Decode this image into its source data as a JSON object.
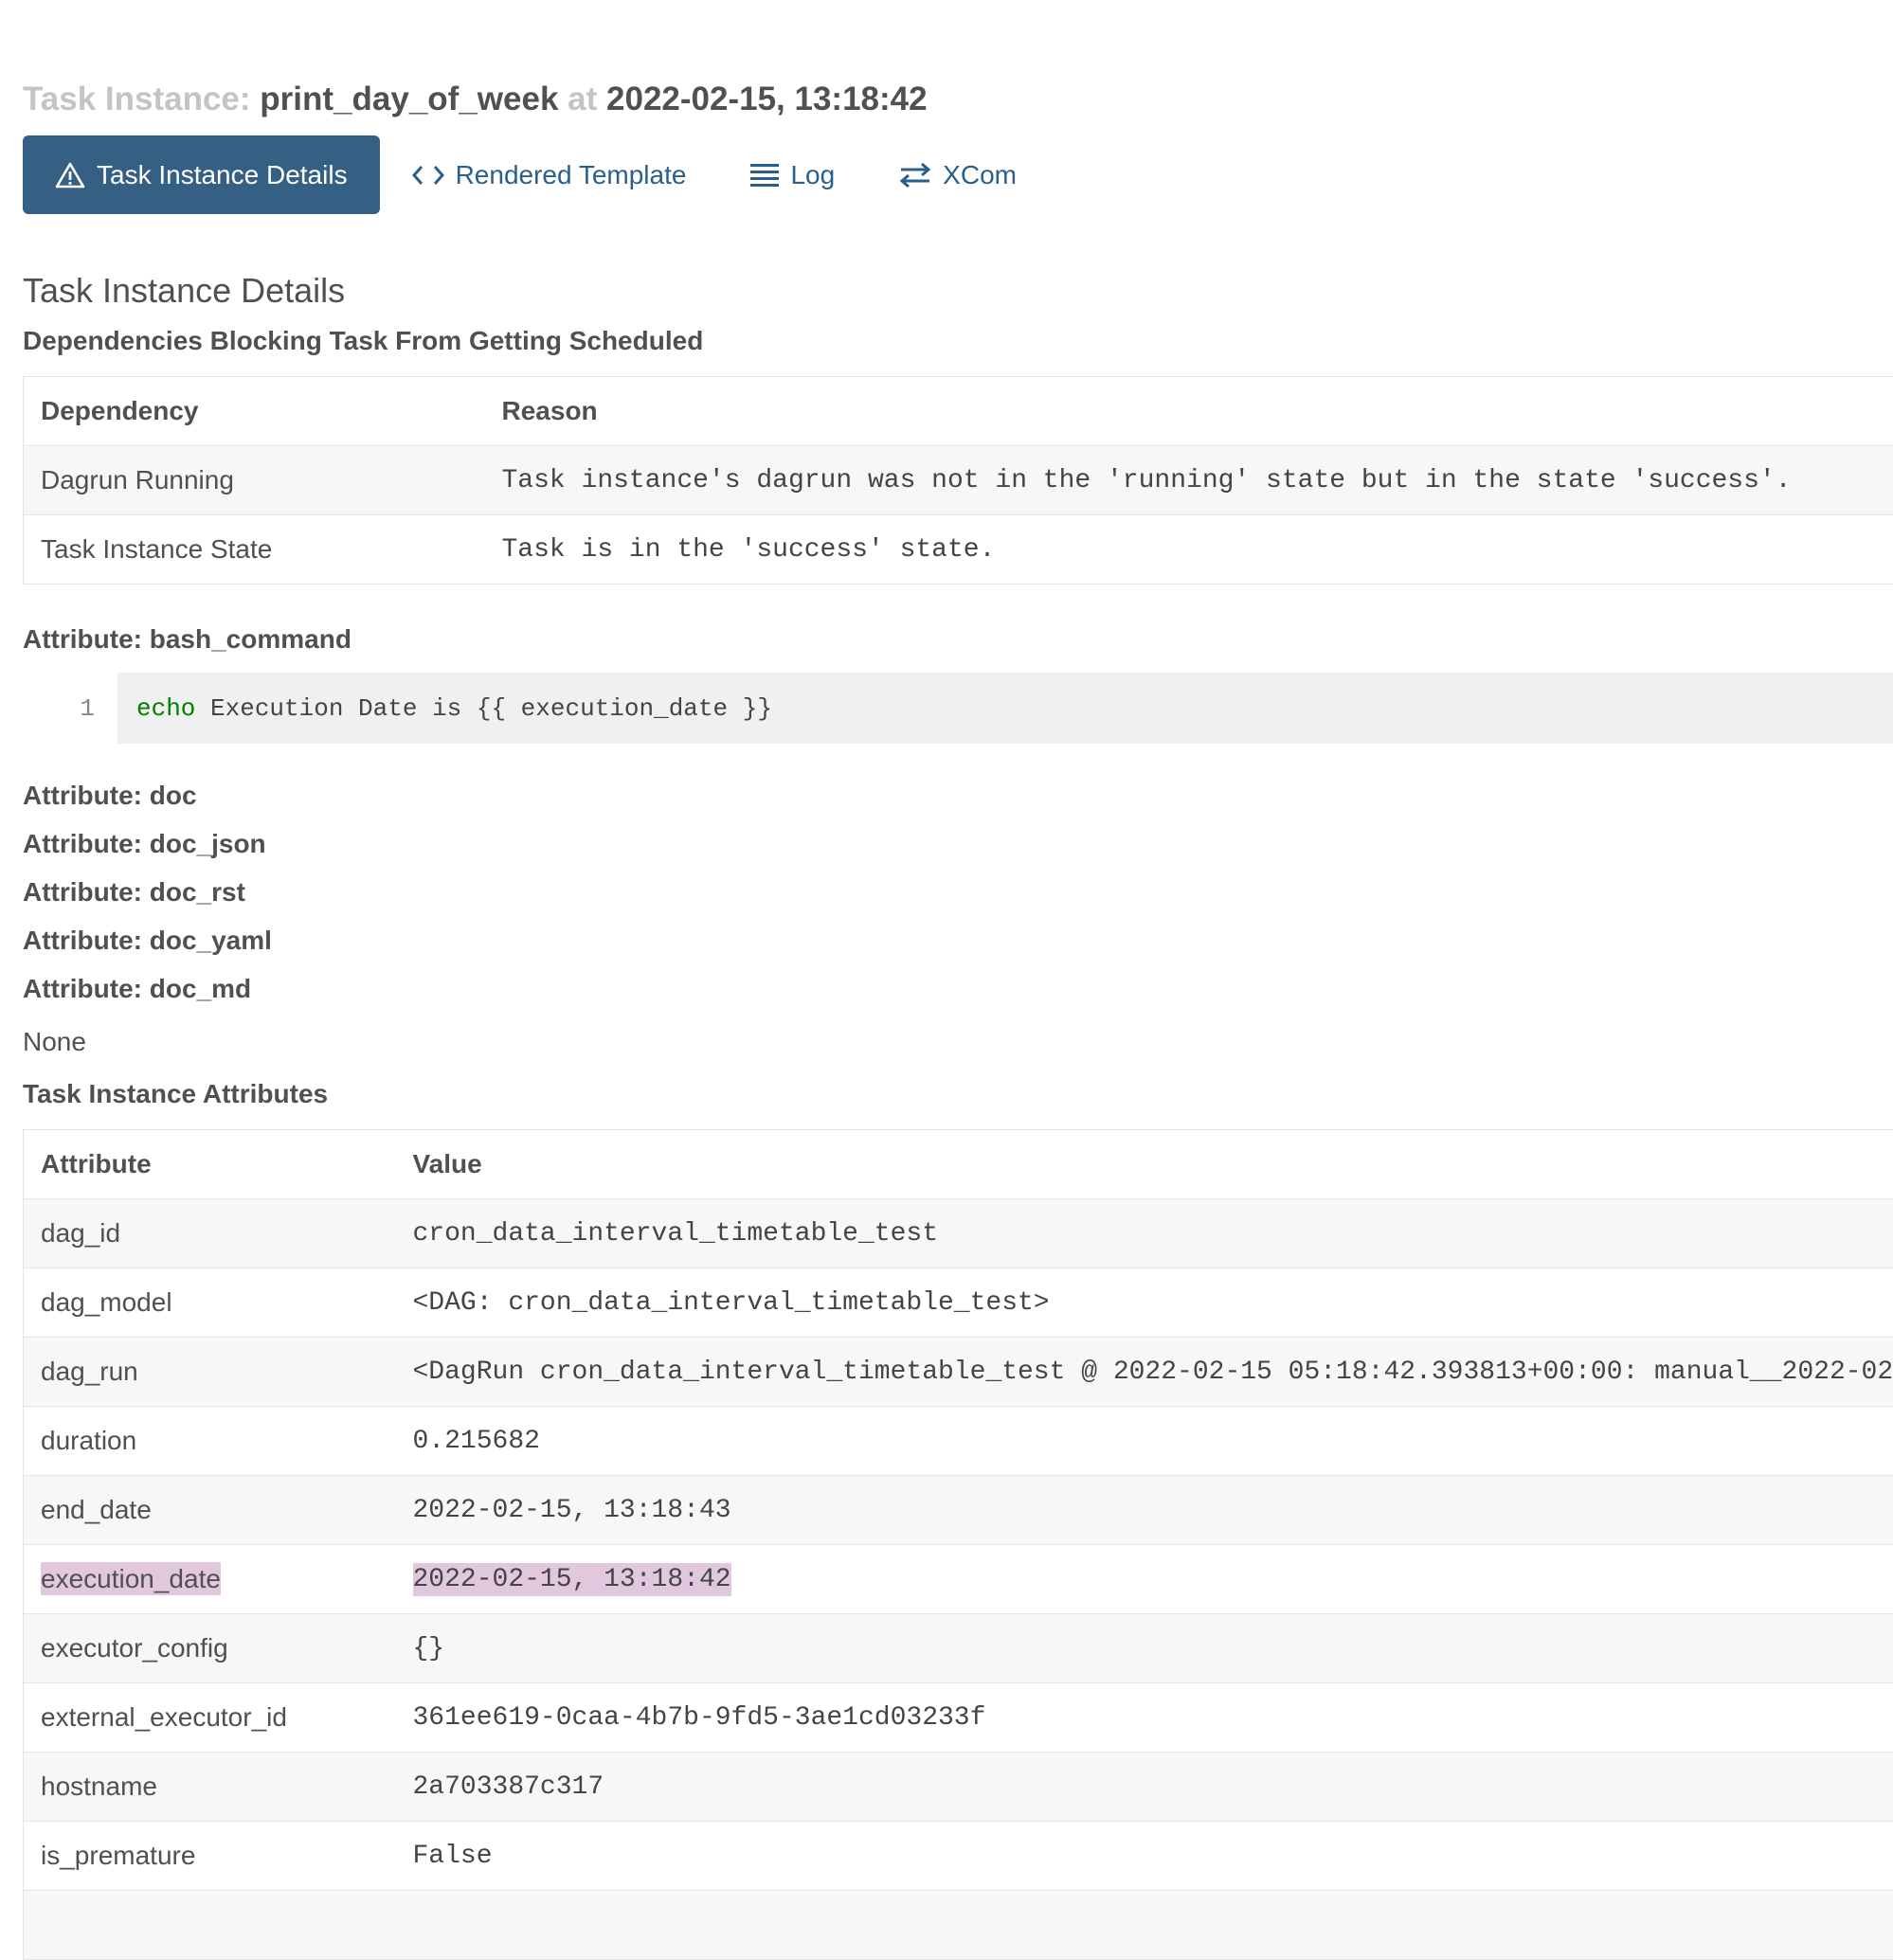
{
  "header": {
    "prefix": "Task Instance:",
    "task_id": "print_day_of_week",
    "at": "at",
    "timestamp": "2022-02-15, 13:18:42"
  },
  "tabs": [
    {
      "label": "Task Instance Details",
      "icon": "warning-icon",
      "active": true
    },
    {
      "label": "Rendered Template",
      "icon": "code-icon",
      "active": false
    },
    {
      "label": "Log",
      "icon": "list-icon",
      "active": false
    },
    {
      "label": "XCom",
      "icon": "exchange-icon",
      "active": false
    }
  ],
  "section_title": "Task Instance Details",
  "deps": {
    "title": "Dependencies Blocking Task From Getting Scheduled",
    "columns": [
      "Dependency",
      "Reason"
    ],
    "rows": [
      [
        "Dagrun Running",
        "Task instance's dagrun was not in the 'running' state but in the state 'success'."
      ],
      [
        "Task Instance State",
        "Task is in the 'success' state."
      ]
    ]
  },
  "bash_command": {
    "label": "Attribute: bash_command",
    "line_number": "1",
    "keyword": "echo",
    "rest": " Execution Date is {{ execution_date }}"
  },
  "doc_attributes": [
    "Attribute: doc",
    "Attribute: doc_json",
    "Attribute: doc_rst",
    "Attribute: doc_yaml",
    "Attribute: doc_md"
  ],
  "doc_md_value": "None",
  "attributes": {
    "title": "Task Instance Attributes",
    "columns": [
      "Attribute",
      "Value"
    ],
    "rows": [
      [
        "dag_id",
        "cron_data_interval_timetable_test"
      ],
      [
        "dag_model",
        "<DAG: cron_data_interval_timetable_test>"
      ],
      [
        "dag_run",
        "<DagRun cron_data_interval_timetable_test @ 2022-02-15 05:18:42.393813+00:00: manual__2022-02"
      ],
      [
        "duration",
        "0.215682"
      ],
      [
        "end_date",
        "2022-02-15, 13:18:43"
      ],
      [
        "execution_date",
        "2022-02-15, 13:18:42"
      ],
      [
        "executor_config",
        "{}"
      ],
      [
        "external_executor_id",
        "361ee619-0caa-4b7b-9fd5-3ae1cd03233f"
      ],
      [
        "hostname",
        "2a703387c317"
      ],
      [
        "is_premature",
        "False"
      ]
    ],
    "highlighted_row": "execution_date"
  },
  "colors": {
    "active_tab_bg": "#365f84",
    "link": "#2a5f8c",
    "highlight": "#e2c8df",
    "code_keyword": "#008000"
  }
}
